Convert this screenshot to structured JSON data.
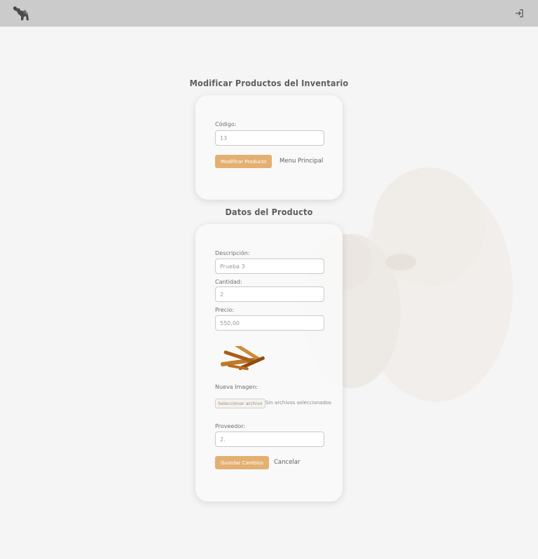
{
  "header": {
    "logo_icon": "dog-cat-logo-icon",
    "logout_icon": "logout-icon"
  },
  "search_section": {
    "title": "Modificar Productos del Inventario",
    "code_label": "Código:",
    "code_value": "13",
    "modify_button": "Modificar Producto",
    "main_menu_link": "Menu Principal"
  },
  "details_section": {
    "title": "Datos del Producto",
    "description_label": "Descripción:",
    "description_value": "Prueba 3",
    "quantity_label": "Cantidad:",
    "quantity_value": "2",
    "price_label": "Precio:",
    "price_value": "550,00",
    "image_icon": "product-image",
    "new_image_label": "Nueva Imagen:",
    "file_button": "Seleccionar archivo",
    "file_status": "Sin archivos seleccionados",
    "supplier_label": "Proveedor:",
    "supplier_value": "2.",
    "save_button": "Guardar Cambios",
    "cancel_link": "Cancelar"
  },
  "colors": {
    "topbar": "#cbcbcb",
    "accent": "#e3b071",
    "background": "#f5f5f5"
  }
}
